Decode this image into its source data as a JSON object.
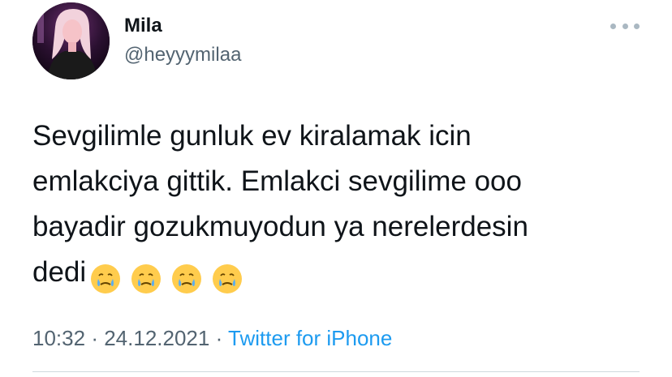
{
  "author": {
    "display_name": "Mila",
    "handle": "@heyyymilaa",
    "avatar_icon": "profile-photo"
  },
  "tweet": {
    "text": "Sevgilimle gunluk ev kiralamak icin\nemlakciya gittik. Emlakci sevgilime ooo\nbayadir gozukmuyodun ya nerelerdesin\ndedi",
    "emojis": [
      "face-holding-back-tears",
      "face-holding-back-tears",
      "face-holding-back-tears",
      "face-holding-back-tears"
    ]
  },
  "meta": {
    "time": "10:32",
    "separator": "·",
    "date": "24.12.2021",
    "source": "Twitter for iPhone"
  },
  "colors": {
    "text": "#0f1419",
    "secondary": "#536471",
    "link": "#1d9bf0",
    "divider": "#cfd9de"
  },
  "more_icon": "ellipsis-icon"
}
